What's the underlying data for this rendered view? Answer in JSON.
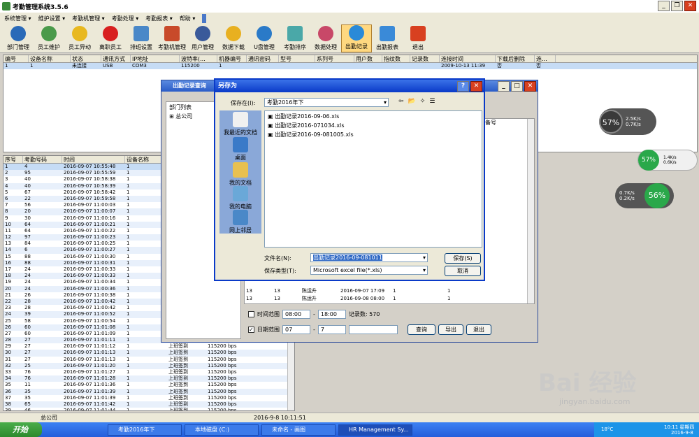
{
  "app": {
    "title": "考勤管理系统3.5.6"
  },
  "menu": [
    "系统管理 ▾",
    "维护设置 ▾",
    "考勤机管理 ▾",
    "考勤处理 ▾",
    "考勤报表 ▾",
    "帮助 ▾"
  ],
  "toolbar": [
    "部门管理",
    "员工维护",
    "员工异动",
    "离职员工",
    "排班设置",
    "考勤机管理",
    "用户管理",
    "数据下载",
    "U盘管理",
    "考勤排序",
    "数据处理",
    "出勤记录",
    "出勤报表",
    "退出"
  ],
  "device_grid": {
    "headers": [
      "编号",
      "设备名称",
      "状态",
      "通讯方式",
      "IP地址",
      "波特率(...",
      "机器编号",
      "通讯密码",
      "型号",
      "系列号",
      "用户数",
      "指纹数",
      "记录数",
      "连接时间",
      "下载后删除",
      "连..."
    ],
    "row": [
      "1",
      "1",
      "未连接",
      "USB",
      "COM3",
      "115200",
      "1",
      "",
      "",
      "",
      "",
      "",
      "",
      "2009-10-13 11:39",
      "否",
      "否"
    ]
  },
  "record_grid": {
    "headers": [
      "序号",
      "考勤号码",
      "时间",
      "设备名称"
    ],
    "rows": [
      [
        "1",
        "4",
        "2016-09-07 10:55:48",
        "1"
      ],
      [
        "2",
        "95",
        "2016-09-07 10:55:59",
        "1"
      ],
      [
        "3",
        "40",
        "2016-09-07 10:58:38",
        "1"
      ],
      [
        "4",
        "40",
        "2016-09-07 10:58:39",
        "1"
      ],
      [
        "5",
        "67",
        "2016-09-07 10:58:42",
        "1"
      ],
      [
        "6",
        "22",
        "2016-09-07 10:59:58",
        "1"
      ],
      [
        "7",
        "56",
        "2016-09-07 11:00:03",
        "1"
      ],
      [
        "8",
        "20",
        "2016-09-07 11:00:07",
        "1"
      ],
      [
        "9",
        "30",
        "2016-09-07 11:00:16",
        "1"
      ],
      [
        "10",
        "64",
        "2016-09-07 11:00:21",
        "1"
      ],
      [
        "11",
        "64",
        "2016-09-07 11:00:22",
        "1"
      ],
      [
        "12",
        "97",
        "2016-09-07 11:00:23",
        "1"
      ],
      [
        "13",
        "84",
        "2016-09-07 11:00:25",
        "1"
      ],
      [
        "14",
        "6",
        "2016-09-07 11:00:27",
        "1"
      ],
      [
        "15",
        "88",
        "2016-09-07 11:00:30",
        "1"
      ],
      [
        "16",
        "88",
        "2016-09-07 11:00:31",
        "1"
      ],
      [
        "17",
        "24",
        "2016-09-07 11:00:33",
        "1"
      ],
      [
        "18",
        "24",
        "2016-09-07 11:00:33",
        "1"
      ],
      [
        "19",
        "24",
        "2016-09-07 11:00:34",
        "1"
      ],
      [
        "20",
        "24",
        "2016-09-07 11:00:36",
        "1"
      ],
      [
        "21",
        "26",
        "2016-09-07 11:00:38",
        "1"
      ],
      [
        "22",
        "28",
        "2016-09-07 11:00:42",
        "1"
      ],
      [
        "23",
        "28",
        "2016-09-07 11:00:42",
        "1"
      ],
      [
        "24",
        "39",
        "2016-09-07 11:00:52",
        "1"
      ],
      [
        "25",
        "58",
        "2016-09-07 11:00:54",
        "1"
      ],
      [
        "26",
        "60",
        "2016-09-07 11:01:08",
        "1"
      ],
      [
        "27",
        "60",
        "2016-09-07 11:01:09",
        "1"
      ],
      [
        "28",
        "27",
        "2016-09-07 11:01:11",
        "1"
      ],
      [
        "29",
        "27",
        "2016-09-07 11:01:12",
        "1"
      ],
      [
        "30",
        "27",
        "2016-09-07 11:01:13",
        "1"
      ],
      [
        "31",
        "27",
        "2016-09-07 11:01:13",
        "1"
      ],
      [
        "32",
        "25",
        "2016-09-07 11:01:20",
        "1"
      ],
      [
        "33",
        "76",
        "2016-09-07 11:01:27",
        "1"
      ],
      [
        "34",
        "76",
        "2016-09-07 11:01:28",
        "1"
      ],
      [
        "35",
        "11",
        "2016-09-07 11:01:36",
        "1"
      ],
      [
        "36",
        "35",
        "2016-09-07 11:01:39",
        "1"
      ],
      [
        "37",
        "35",
        "2016-09-07 11:01:39",
        "1"
      ],
      [
        "38",
        "65",
        "2016-09-07 11:01:42",
        "1"
      ],
      [
        "39",
        "46",
        "2016-09-07 11:01:44",
        "1"
      ]
    ],
    "extra_cols": {
      "label": "上班签到",
      "baud": "115200 bps"
    }
  },
  "query_dialog": {
    "title": "出勤记录查询",
    "dept_label": "部门列表",
    "tree_root": "总公司",
    "col_hint": "备号",
    "rows": [
      [
        "13",
        "13",
        "陈运升",
        "2016-09-07 17:09",
        "1",
        "1"
      ],
      [
        "13",
        "13",
        "陈运升",
        "2016-09-08 08:00",
        "1",
        "1"
      ]
    ],
    "time_range": "时间范围",
    "time_from": "08:00",
    "time_to": "18:00",
    "record_count": "记录数: 570",
    "date_range": "日期范围",
    "date_from": "07",
    "date_to": "7",
    "btn_query": "查询",
    "btn_export": "导出",
    "btn_exit": "退出"
  },
  "saveas": {
    "title": "另存为",
    "save_in_label": "保存在(I):",
    "folder": "考勤2016年下",
    "files": [
      "出勤记录2016-09-06.xls",
      "出勤记录2016-071034.xls",
      "出勤记录2016-09-081005.xls"
    ],
    "places": [
      "我最近的文档",
      "桌面",
      "我的文档",
      "我的电脑",
      "网上邻居"
    ],
    "filename_label": "文件名(N):",
    "filename": "出勤记录2016-09-081011",
    "filetype_label": "保存类型(T):",
    "filetype": "Microsoft excel file(*.xls)",
    "btn_save": "保存(S)",
    "btn_cancel": "取消"
  },
  "statusbar": {
    "company": "总公司",
    "datetime": "2016-9-8 10:11:51"
  },
  "meters": [
    {
      "pct": "57%",
      "up": "2.5K/s",
      "down": "0.7K/s"
    },
    {
      "pct": "57%",
      "up": "1.4K/s",
      "down": "0.6K/s"
    },
    {
      "pct": "56%",
      "up": "0.7K/s",
      "down": "0.2K/s"
    }
  ],
  "taskbar": {
    "start": "开始",
    "tasks": [
      "考勤2016年下",
      "本地磁盘 (C:)",
      "未命名 - 画图",
      "HR Management Sy..."
    ],
    "temp": "18°C",
    "clock": "10:11 星期四",
    "date": "2016-9-8"
  },
  "watermark": {
    "line1": "Bai 经验",
    "line2": "jingyan.baidu.com"
  },
  "colors": {
    "accent": "#0a3ac8",
    "selection": "#c6dcf5"
  }
}
